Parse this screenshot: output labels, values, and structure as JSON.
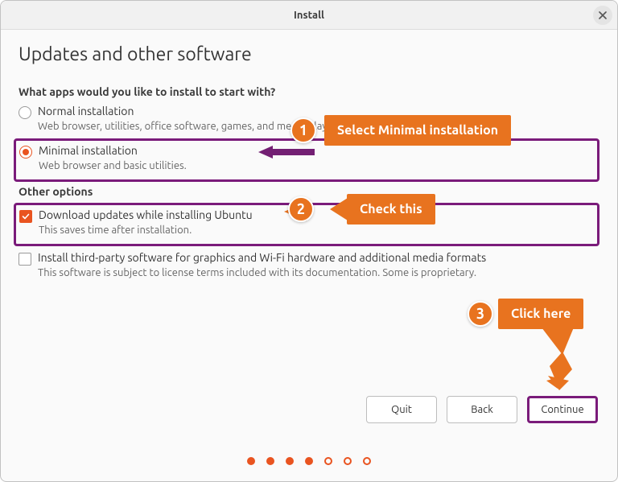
{
  "window": {
    "title": "Install"
  },
  "page": {
    "heading": "Updates and other software",
    "question": "What apps would you like to install to start with?",
    "normal": {
      "label": "Normal installation",
      "desc": "Web browser, utilities, office software, games, and media players."
    },
    "minimal": {
      "label": "Minimal installation",
      "desc": "Web browser and basic utilities."
    },
    "other_heading": "Other options",
    "download": {
      "label": "Download updates while installing Ubuntu",
      "desc": "This saves time after installation."
    },
    "thirdparty": {
      "label": "Install third-party software for graphics and Wi-Fi hardware and additional media formats",
      "desc": "This software is subject to license terms included with its documentation. Some is proprietary."
    }
  },
  "buttons": {
    "quit": "Quit",
    "back": "Back",
    "continue": "Continue"
  },
  "callouts": {
    "c1": {
      "num": "1",
      "text": "Select Minimal installation"
    },
    "c2": {
      "num": "2",
      "text": "Check this"
    },
    "c3": {
      "num": "3",
      "text": "Click here"
    }
  },
  "progress": {
    "total": 7,
    "filled": 4
  }
}
